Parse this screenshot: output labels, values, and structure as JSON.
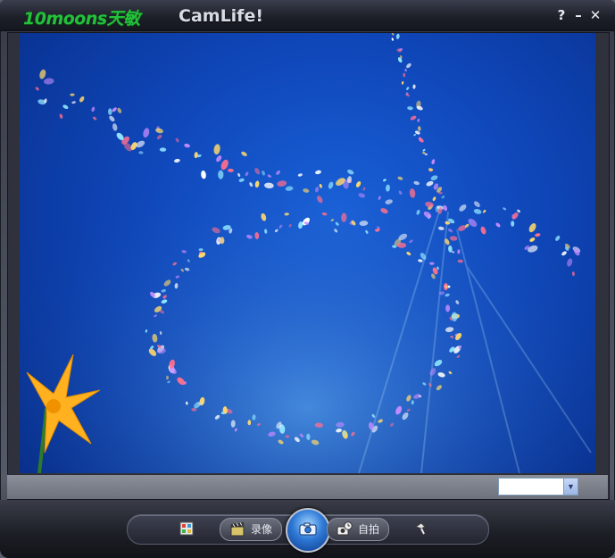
{
  "titlebar": {
    "brand": "10moons天敏",
    "app_name": "CamLife!",
    "help_label": "?",
    "minimize_label": "–",
    "close_label": "✕"
  },
  "preview": {
    "background_color": "#0f46b8",
    "accent_petals": [
      "#ff6f8e",
      "#ffd86b",
      "#8fe4ff",
      "#ffffff",
      "#c28cff"
    ]
  },
  "controls": {
    "resolution_value": "",
    "grid_icon": "grid-view-icon",
    "record_label": "录像",
    "record_icon": "clapperboard-icon",
    "capture_icon": "camera-icon",
    "selftimer_label": "自拍",
    "selftimer_icon": "timer-camera-icon",
    "settings_icon": "pin-tool-icon"
  }
}
